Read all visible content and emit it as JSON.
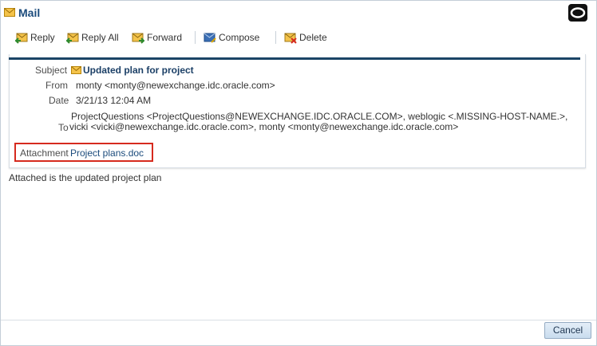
{
  "window": {
    "title": "Mail",
    "icon": "envelope-icon",
    "brand_icon": "oracle-logo-icon"
  },
  "toolbar": {
    "reply_label": "Reply",
    "reply_all_label": "Reply All",
    "forward_label": "Forward",
    "compose_label": "Compose",
    "delete_label": "Delete"
  },
  "message": {
    "subject_label": "Subject",
    "subject": "Updated plan for project",
    "from_label": "From",
    "from": "monty <monty@newexchange.idc.oracle.com>",
    "date_label": "Date",
    "date": "3/21/13 12:04 AM",
    "to_label": "To",
    "to_line1": "ProjectQuestions <ProjectQuestions@NEWEXCHANGE.IDC.ORACLE.COM>, weblogic <.MISSING-HOST-NAME.>,",
    "to_line2": "vicki <vicki@newexchange.idc.oracle.com>, monty  <monty@newexchange.idc.oracle.com>",
    "attachment_label": "Attachment",
    "attachment": "Project plans.doc",
    "body": "Attached is the updated project plan"
  },
  "footer": {
    "cancel_label": "Cancel"
  },
  "colors": {
    "title": "#1b4b7c",
    "header_rule": "#1b4466",
    "highlight_box": "#d62a1e",
    "button_bg": "#c9dcee"
  }
}
